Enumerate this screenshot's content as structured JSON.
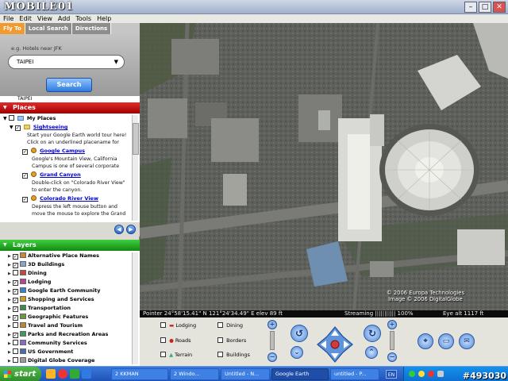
{
  "window": {
    "title": "MOBILE01"
  },
  "menu": [
    "File",
    "Edit",
    "View",
    "Add",
    "Tools",
    "Help"
  ],
  "tabs": {
    "fly_to": "Fly To",
    "local_search": "Local Search",
    "directions": "Directions"
  },
  "fly_to": {
    "hint": "e.g. Hotels near JFK",
    "value": "TAIPEI",
    "search_label": "Search"
  },
  "places": {
    "header": "Places",
    "partial_row": "TAIPEI",
    "my_places": "My Places",
    "sightseeing": "Sightseeing",
    "intro": [
      "Start your Google Earth world tour here!",
      "Click on an underlined placename for"
    ],
    "items": [
      {
        "name": "Google Campus",
        "desc": [
          "Google's Mountain View, California",
          "Campus is one of several corporate"
        ]
      },
      {
        "name": "Grand Canyon",
        "desc": [
          "Double-click on \"Colorado River View\"",
          "to enter the canyon."
        ]
      },
      {
        "name": "Colorado River View",
        "desc": [
          "Depress the left mouse button and",
          "move the mouse to explore the Grand"
        ]
      }
    ]
  },
  "layers": {
    "header": "Layers",
    "items": [
      {
        "label": "Alternative Place Names",
        "checked": true
      },
      {
        "label": "3D Buildings",
        "checked": true
      },
      {
        "label": "Dining",
        "checked": false
      },
      {
        "label": "Lodging",
        "checked": true
      },
      {
        "label": "Google Earth Community",
        "checked": true
      },
      {
        "label": "Shopping and Services",
        "checked": true
      },
      {
        "label": "Transportation",
        "checked": true
      },
      {
        "label": "Geographic Features",
        "checked": true
      },
      {
        "label": "Travel and Tourism",
        "checked": false
      },
      {
        "label": "Parks and Recreation Areas",
        "checked": true
      },
      {
        "label": "Community Services",
        "checked": false
      },
      {
        "label": "US Government",
        "checked": false
      },
      {
        "label": "Digital Globe Coverage",
        "checked": false
      }
    ]
  },
  "map": {
    "copyright_1": "© 2006 Europa Technologies",
    "copyright_2": "Image © 2006 DigitalGlobe"
  },
  "status": {
    "pointer": "Pointer  24°58'15.41\" N   121°24'34.49\" E   elev   89 ft",
    "streaming": "Streaming ||||||||||| 100%",
    "eye_alt": "Eye  alt    1117 ft"
  },
  "controls": {
    "lodging": "Lodging",
    "dining": "Dining",
    "roads": "Roads",
    "borders": "Borders",
    "terrain": "Terrain",
    "buildings": "Buildings"
  },
  "taskbar": {
    "start": "start",
    "items": [
      "2 KKMAN",
      "2 Windo...",
      "Untitled - N...",
      "Google Earth",
      "untitled - P..."
    ],
    "lang": "EN",
    "watermark": "#493030"
  }
}
